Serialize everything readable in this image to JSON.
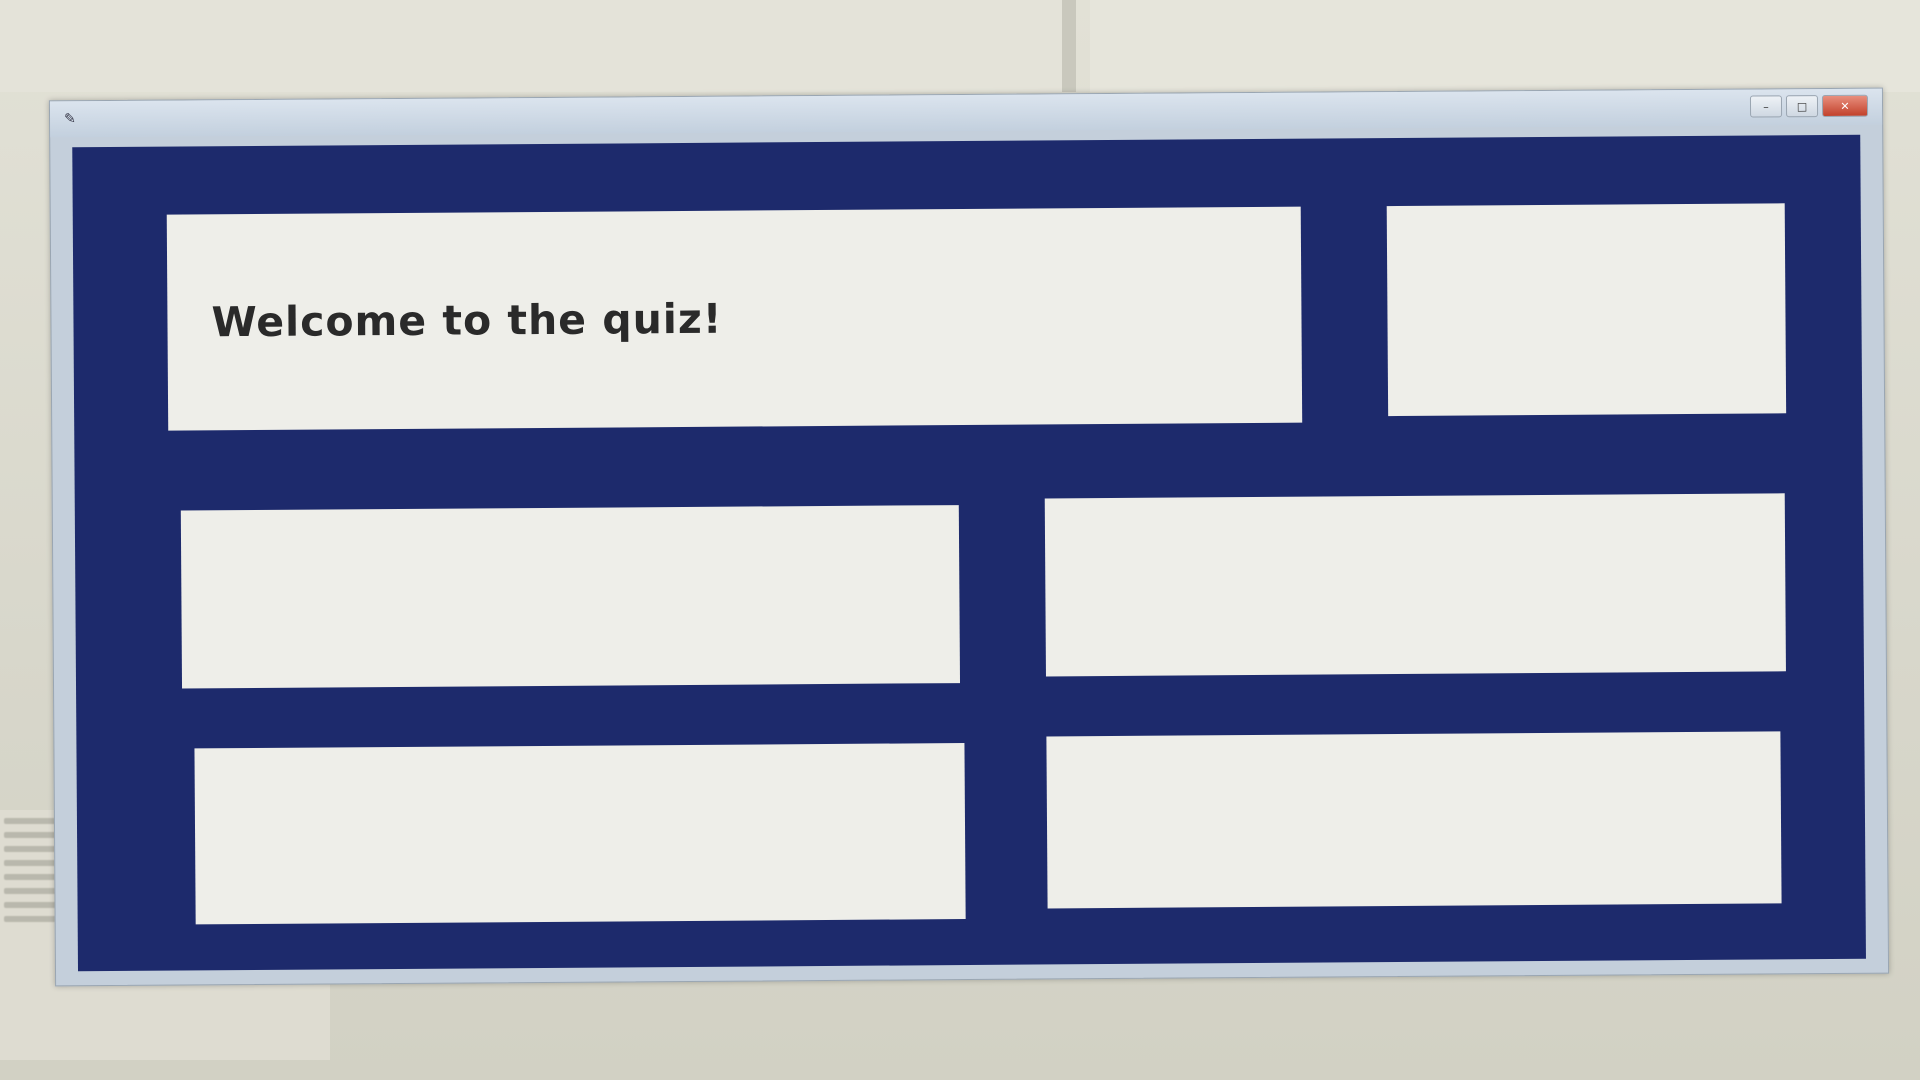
{
  "app": {
    "window_title": "",
    "welcome_text": "Welcome to the quiz!",
    "score_text": "",
    "answers": [
      "",
      "",
      "",
      ""
    ],
    "controls": {
      "minimize": "–",
      "maximize": "□",
      "close": "✕"
    }
  },
  "colors": {
    "frame_background": "#1d2a6c",
    "panel_background": "#eeeee9"
  }
}
